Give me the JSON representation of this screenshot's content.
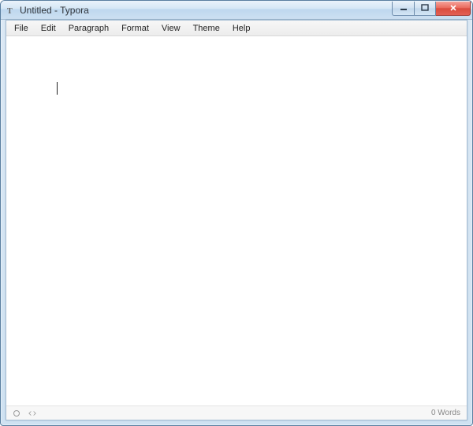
{
  "window": {
    "title": "Untitled - Typora"
  },
  "menu": {
    "items": [
      "File",
      "Edit",
      "Paragraph",
      "Format",
      "View",
      "Theme",
      "Help"
    ]
  },
  "editor": {
    "content": ""
  },
  "status": {
    "words": "0 Words"
  }
}
